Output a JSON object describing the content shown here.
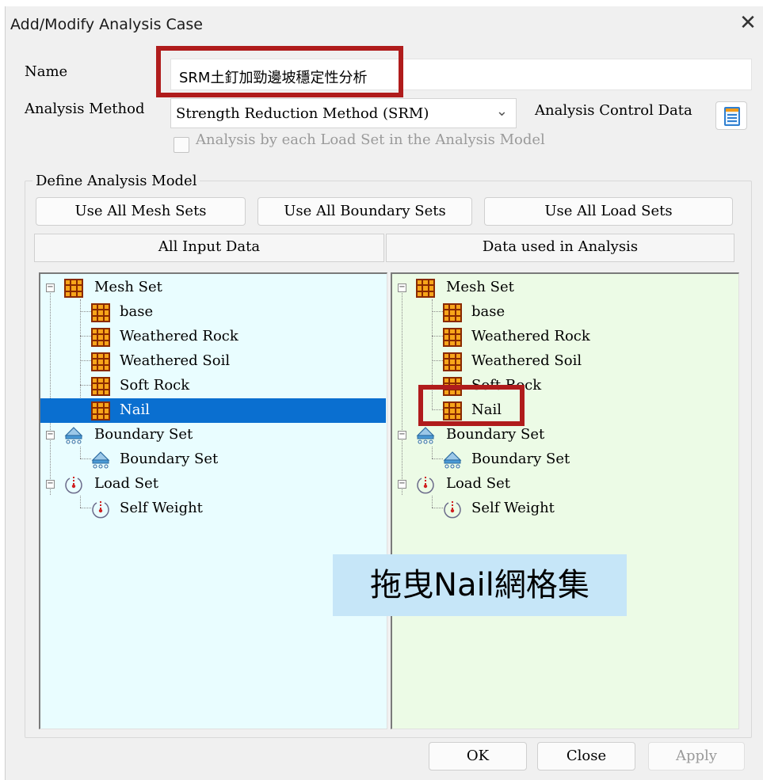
{
  "window": {
    "title": "Add/Modify Analysis Case",
    "close_glyph": "✕"
  },
  "name": {
    "label": "Name",
    "value": "SRM土釘加勁邊坡穩定性分析"
  },
  "analysis_method": {
    "label": "Analysis Method",
    "selected": "Strength Reduction Method (SRM)"
  },
  "analysis_control": {
    "label": "Analysis Control Data",
    "icon": "control-data-icon"
  },
  "by_load_set": {
    "label": "Analysis by each Load Set in the Analysis Model",
    "checked": false,
    "enabled": false
  },
  "define_model": {
    "title": "Define Analysis Model",
    "buttons": {
      "mesh": "Use All Mesh Sets",
      "boundary": "Use All Boundary Sets",
      "load": "Use All Load Sets"
    },
    "left_header": "All Input Data",
    "right_header": "Data used in Analysis",
    "left_tree": {
      "mesh_set": "Mesh Set",
      "mesh_items": [
        "base",
        "Weathered Rock",
        "Weathered Soil",
        "Soft Rock",
        "Nail"
      ],
      "selected": "Nail",
      "boundary_set": "Boundary Set",
      "boundary_items": [
        "Boundary Set"
      ],
      "load_set": "Load Set",
      "load_items": [
        "Self Weight"
      ]
    },
    "right_tree": {
      "mesh_set": "Mesh Set",
      "mesh_items": [
        "base",
        "Weathered Rock",
        "Weathered Soil",
        "Soft Rock",
        "Nail"
      ],
      "boundary_set": "Boundary Set",
      "boundary_items": [
        "Boundary Set"
      ],
      "load_set": "Load Set",
      "load_items": [
        "Self Weight"
      ]
    }
  },
  "footer": {
    "ok": "OK",
    "close": "Close",
    "apply": "Apply"
  },
  "annotation": {
    "text": "拖曳Nail網格集"
  },
  "colors": {
    "highlight_red": "#b01c1c",
    "selection_blue": "#0a6fd0",
    "left_panel_bg": "#e9fdff",
    "right_panel_bg": "#ecfbe6",
    "callout_bg": "#c6e6f8"
  }
}
